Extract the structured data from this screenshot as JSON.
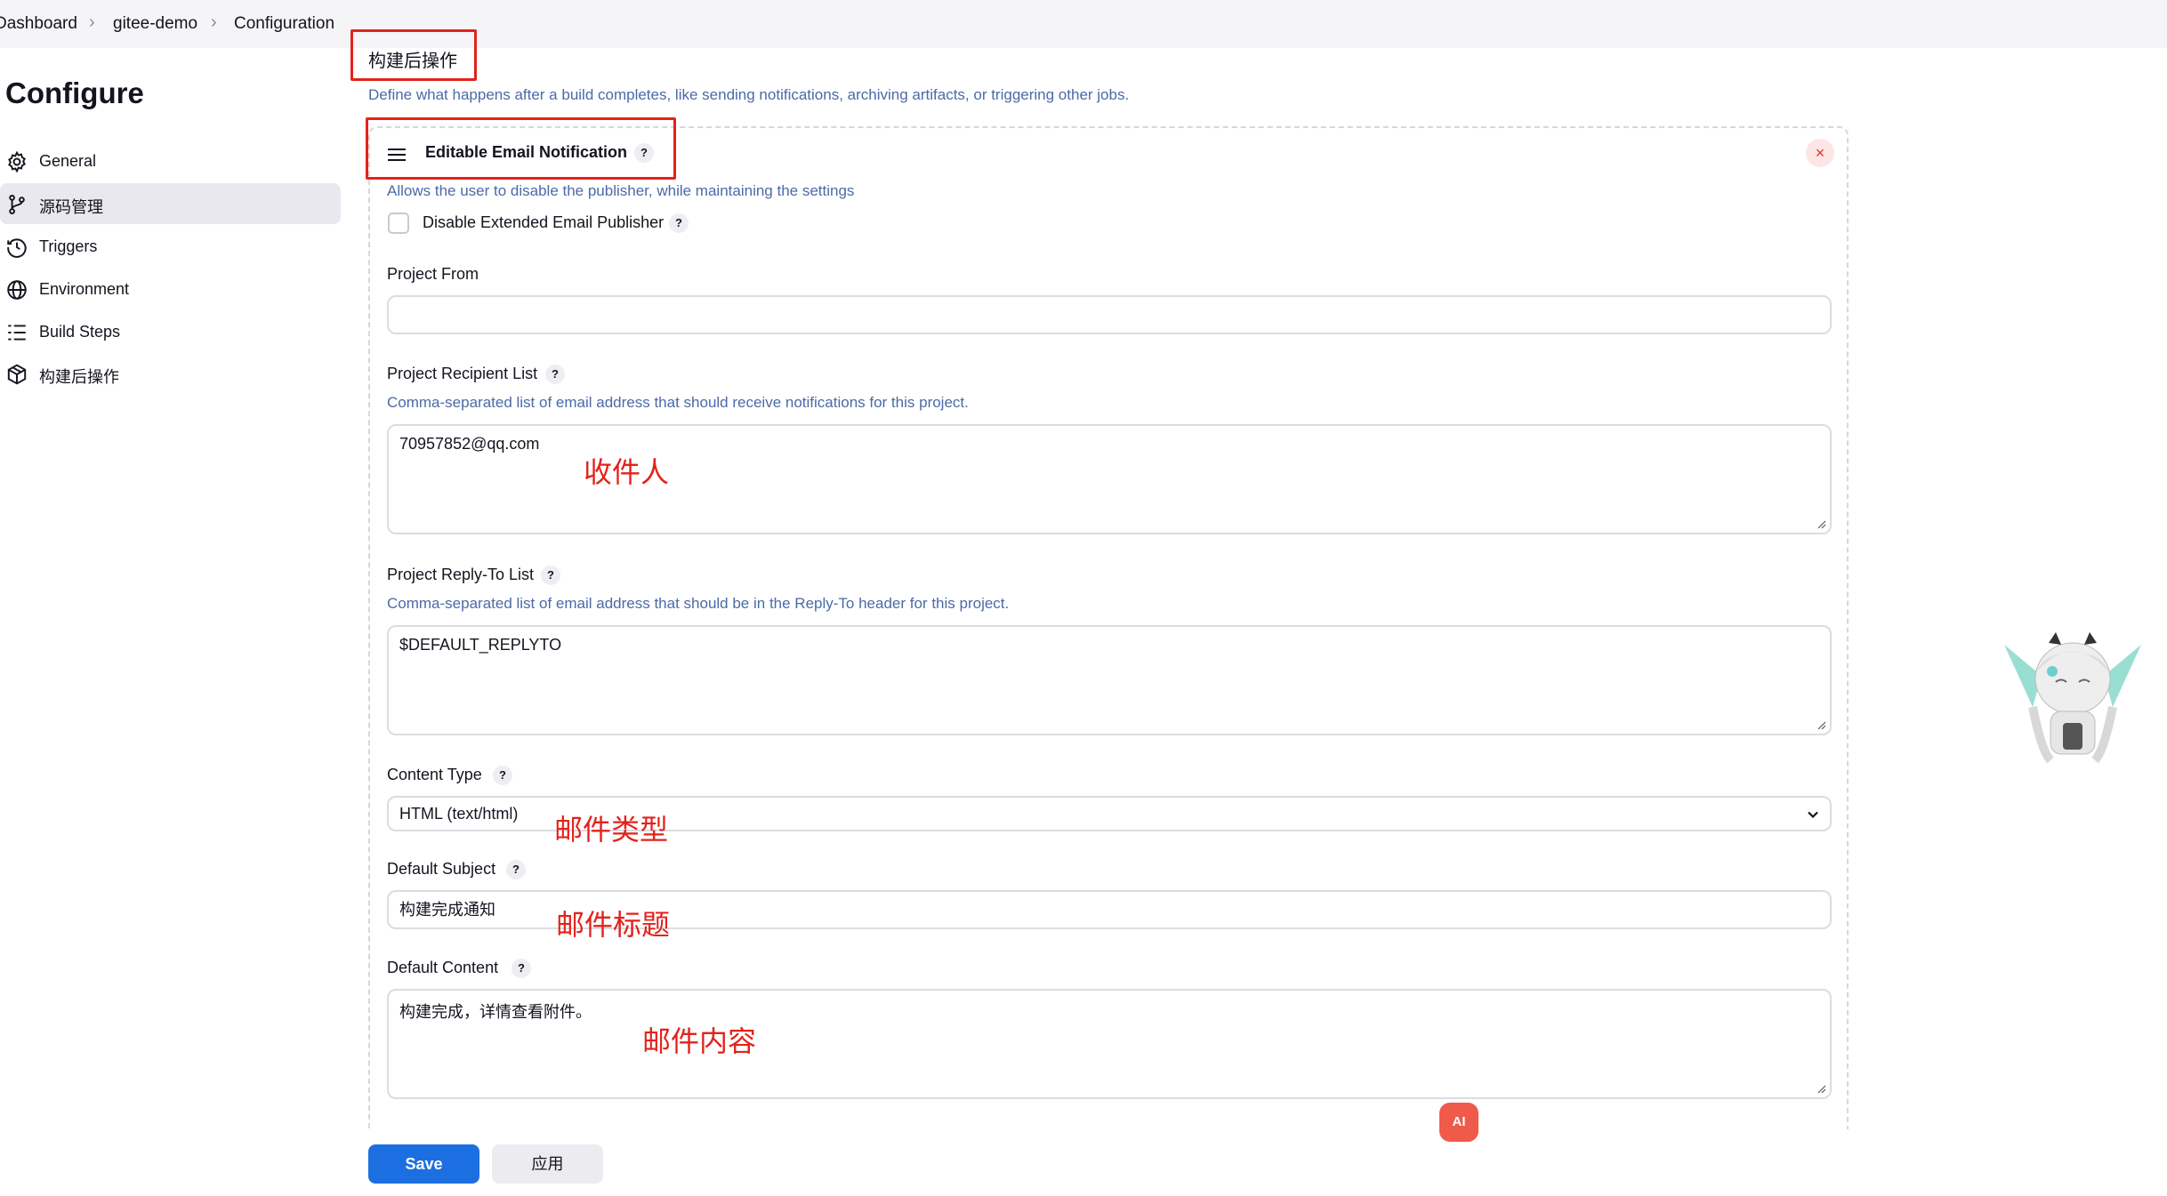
{
  "breadcrumb": {
    "items": [
      "Dashboard",
      "gitee-demo",
      "Configuration"
    ]
  },
  "sidebar": {
    "title": "Configure",
    "items": [
      {
        "label": "General",
        "icon": "gear-icon",
        "active": false
      },
      {
        "label": "源码管理",
        "icon": "git-branch-icon",
        "active": true
      },
      {
        "label": "Triggers",
        "icon": "clock-icon",
        "active": false
      },
      {
        "label": "Environment",
        "icon": "globe-icon",
        "active": false
      },
      {
        "label": "Build Steps",
        "icon": "list-icon",
        "active": false
      },
      {
        "label": "构建后操作",
        "icon": "package-icon",
        "active": false
      }
    ]
  },
  "section": {
    "title": "构建后操作",
    "description": "Define what happens after a build completes, like sending notifications, archiving artifacts, or triggering other jobs."
  },
  "publisher": {
    "title": "Editable Email Notification",
    "help": "?",
    "close": "×",
    "disable_desc": "Allows the user to disable the publisher, while maintaining the settings",
    "disable_label": "Disable Extended Email Publisher",
    "disable_checked": false
  },
  "fields": {
    "project_from": {
      "label": "Project From",
      "value": ""
    },
    "recipient_list": {
      "label": "Project Recipient List",
      "desc": "Comma-separated list of email address that should receive notifications for this project.",
      "value": "70957852@qq.com"
    },
    "reply_to_list": {
      "label": "Project Reply-To List",
      "desc": "Comma-separated list of email address that should be in the Reply-To header for this project.",
      "value": "$DEFAULT_REPLYTO"
    },
    "content_type": {
      "label": "Content Type",
      "value": "HTML (text/html)"
    },
    "default_subject": {
      "label": "Default Subject",
      "value": "构建完成通知"
    },
    "default_content": {
      "label": "Default Content",
      "value": "构建完成，详情查看附件。"
    }
  },
  "annotations": {
    "recipient": "收件人",
    "content_type": "邮件类型",
    "subject": "邮件标题",
    "content": "邮件内容"
  },
  "buttons": {
    "save": "Save",
    "apply": "应用"
  },
  "ai_badge": "AI",
  "colors": {
    "accent": "#1c6fe0",
    "annotation_red": "#e3221b",
    "link_blue": "#4b6aa8",
    "sidebar_active": "#e8e8ee"
  }
}
